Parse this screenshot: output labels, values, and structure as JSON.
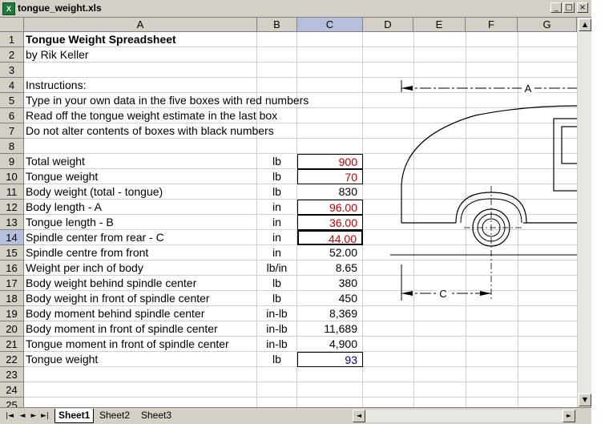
{
  "window": {
    "title": "tongue_weight.xls",
    "minimize": "_",
    "maximize": "□",
    "close": "×"
  },
  "columns": [
    "A",
    "B",
    "C",
    "D",
    "E",
    "F",
    "G"
  ],
  "rows": [
    {
      "n": "1",
      "a": "Tongue Weight Spreadsheet",
      "b": "",
      "c": ""
    },
    {
      "n": "2",
      "a": "by Rik Keller",
      "b": "",
      "c": ""
    },
    {
      "n": "3",
      "a": "",
      "b": "",
      "c": ""
    },
    {
      "n": "4",
      "a": "Instructions:",
      "b": "",
      "c": ""
    },
    {
      "n": "5",
      "a": "Type in your own data in the five boxes with red numbers",
      "b": "",
      "c": ""
    },
    {
      "n": "6",
      "a": "Read off the tongue weight estimate in the last box",
      "b": "",
      "c": ""
    },
    {
      "n": "7",
      "a": "Do not alter contents of boxes with black numbers",
      "b": "",
      "c": ""
    },
    {
      "n": "8",
      "a": "",
      "b": "",
      "c": ""
    },
    {
      "n": "9",
      "a": "Total weight",
      "b": "lb",
      "c": "900"
    },
    {
      "n": "10",
      "a": "Tongue weight",
      "b": "lb",
      "c": "70"
    },
    {
      "n": "11",
      "a": "Body weight (total - tongue)",
      "b": "lb",
      "c": "830"
    },
    {
      "n": "12",
      "a": "Body length - A",
      "b": "in",
      "c": "96.00"
    },
    {
      "n": "13",
      "a": "Tongue length - B",
      "b": "in",
      "c": "36.00"
    },
    {
      "n": "14",
      "a": "Spindle center from rear - C",
      "b": "in",
      "c": "44.00"
    },
    {
      "n": "15",
      "a": "Spindle centre from front",
      "b": "in",
      "c": "52.00"
    },
    {
      "n": "16",
      "a": "Weight per inch of body",
      "b": "lb/in",
      "c": "8.65"
    },
    {
      "n": "17",
      "a": "Body weight behind spindle center",
      "b": "lb",
      "c": "380"
    },
    {
      "n": "18",
      "a": "Body weight in front of spindle center",
      "b": "lb",
      "c": "450"
    },
    {
      "n": "19",
      "a": "Body moment behind spindle center",
      "b": "in-lb",
      "c": "8,369"
    },
    {
      "n": "20",
      "a": "Body moment in front of spindle center",
      "b": "in-lb",
      "c": "11,689"
    },
    {
      "n": "21",
      "a": "Tongue moment in front of spindle center",
      "b": "in-lb",
      "c": "4,900"
    },
    {
      "n": "22",
      "a": "Tongue weight",
      "b": "lb",
      "c": "93"
    },
    {
      "n": "23",
      "a": "",
      "b": "",
      "c": ""
    },
    {
      "n": "24",
      "a": "",
      "b": "",
      "c": ""
    },
    {
      "n": "25",
      "a": "",
      "b": "",
      "c": ""
    }
  ],
  "cell_styles": {
    "bold_rows": [
      1
    ],
    "red_input_rows": [
      9,
      10,
      12,
      13,
      14
    ],
    "blue_result_rows": [
      22
    ],
    "active_row": 14,
    "selected_column": "C"
  },
  "colors": {
    "input_text": "#c00000",
    "result_text": "#000080",
    "header_selected": "#b6c0dc"
  },
  "diagram": {
    "label_a": "A",
    "label_c": "C"
  },
  "sheets": [
    {
      "name": "Sheet1",
      "active": true
    },
    {
      "name": "Sheet2",
      "active": false
    },
    {
      "name": "Sheet3",
      "active": false
    }
  ],
  "nav": {
    "first": "|◄",
    "prev": "◄",
    "next": "►",
    "last": "►|"
  },
  "scroll": {
    "up": "▲",
    "down": "▼",
    "left": "◄",
    "right": "►"
  }
}
